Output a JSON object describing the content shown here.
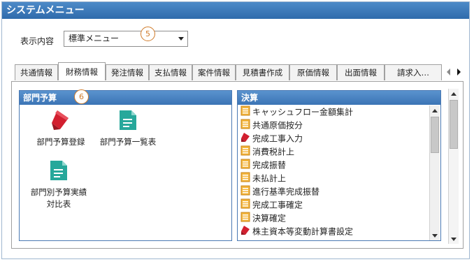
{
  "window": {
    "title": "システムメニュー"
  },
  "display": {
    "label": "表示内容",
    "selected": "標準メニュー"
  },
  "markers": {
    "m5": "5",
    "m6": "6"
  },
  "tabs": [
    {
      "label": "共通情報"
    },
    {
      "label": "財務情報"
    },
    {
      "label": "発注情報"
    },
    {
      "label": "支払情報"
    },
    {
      "label": "案件情報"
    },
    {
      "label": "見積書作成"
    },
    {
      "label": "原価情報"
    },
    {
      "label": "出面情報"
    },
    {
      "label": "請求入…"
    }
  ],
  "budget": {
    "title": "部門予算",
    "items": [
      {
        "label": "部門予算登録",
        "icon": "pencil-icon"
      },
      {
        "label": "部門予算一覧表",
        "icon": "document-icon"
      },
      {
        "label": "部門別予算実績対比表",
        "icon": "document-icon"
      }
    ]
  },
  "settlement": {
    "title": "決算",
    "items": [
      {
        "label": "キャッシュフロー金額集計",
        "icon": "ledger-icon"
      },
      {
        "label": "共通原価按分",
        "icon": "ledger-icon"
      },
      {
        "label": "完成工事入力",
        "icon": "pencil-icon"
      },
      {
        "label": "消費税計上",
        "icon": "ledger-icon"
      },
      {
        "label": "完成振替",
        "icon": "ledger-icon"
      },
      {
        "label": "未払計上",
        "icon": "ledger-icon"
      },
      {
        "label": "進行基準完成振替",
        "icon": "ledger-icon"
      },
      {
        "label": "完成工事確定",
        "icon": "ledger-icon"
      },
      {
        "label": "決算確定",
        "icon": "ledger-icon"
      },
      {
        "label": "株主資本等変動計算書設定",
        "icon": "pencil-icon"
      }
    ]
  },
  "colors": {
    "accent": "#3b74b5",
    "marker": "#d07b2a",
    "pencil": "#d21f2f",
    "doc": "#27a89b",
    "ledger": "#e8a21c"
  }
}
